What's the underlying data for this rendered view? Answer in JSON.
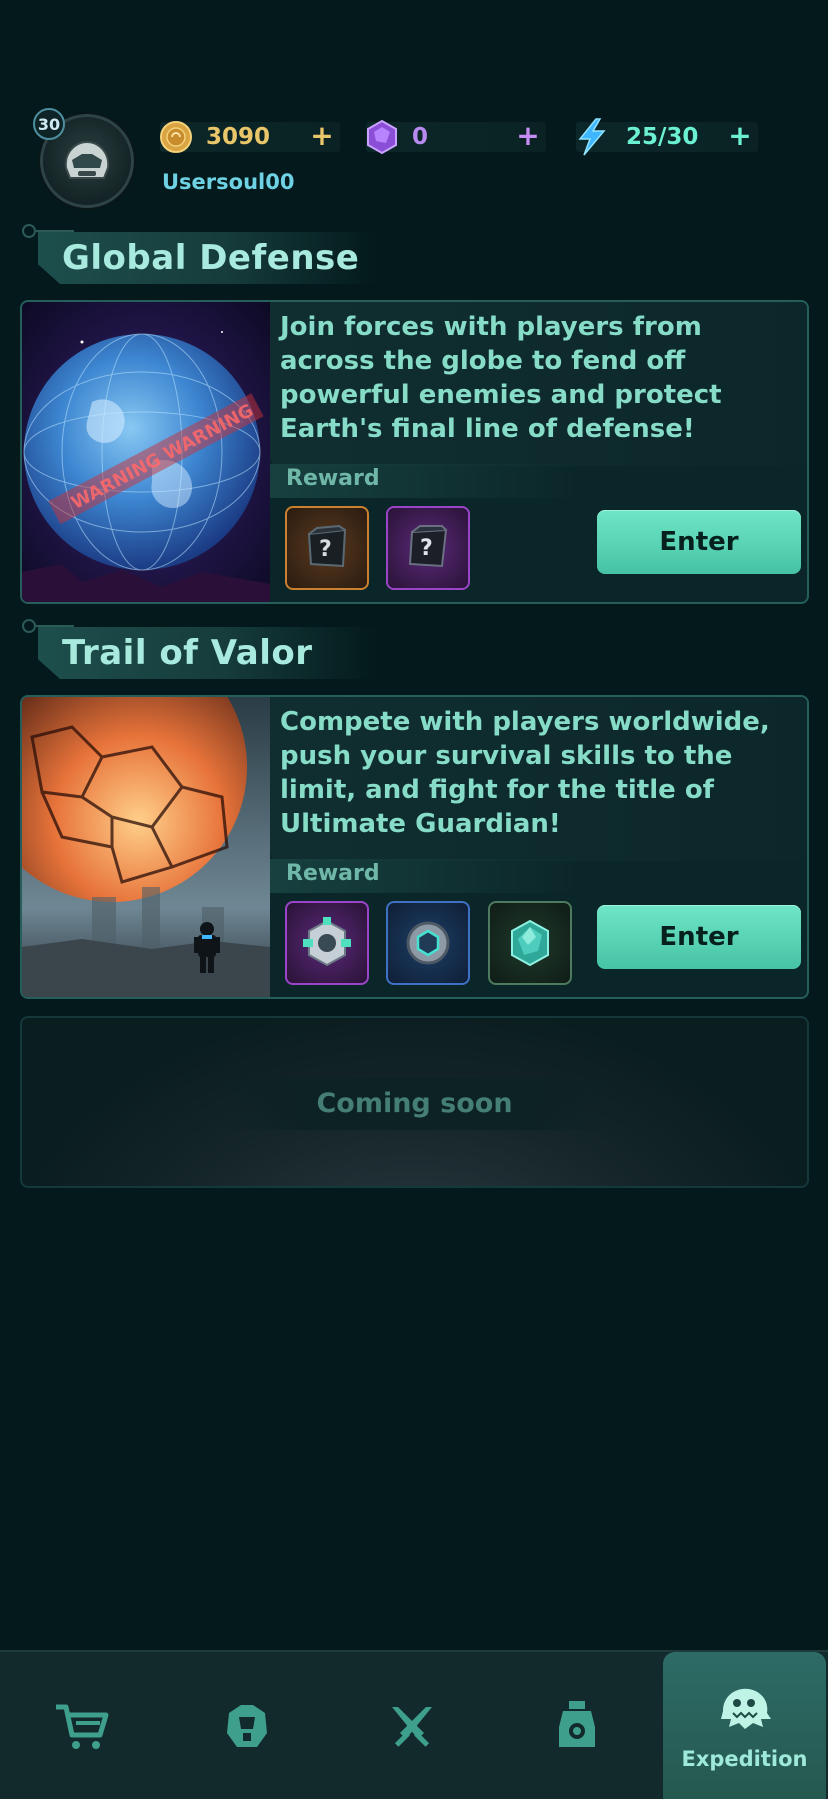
{
  "player": {
    "level": "30",
    "username": "Usersoul00"
  },
  "resources": {
    "coins": {
      "value": "3090",
      "icon": "coin-icon",
      "add_label": "+"
    },
    "gems": {
      "value": "0",
      "icon": "gem-icon",
      "add_label": "+"
    },
    "energy": {
      "value": "25/30",
      "icon": "lightning-icon",
      "add_label": "+"
    }
  },
  "events": [
    {
      "title": "Global Defense",
      "description": "Join forces with players from across the globe to fend off powerful enemies and protect Earth's final line of defense!",
      "reward_label": "Reward",
      "rewards": [
        {
          "icon": "mystery-chest-orange-icon",
          "rarity": "orange"
        },
        {
          "icon": "mystery-chest-purple-icon",
          "rarity": "purple"
        }
      ],
      "enter_label": "Enter",
      "art": "warning-globe",
      "art_text": "WARNING WARNING"
    },
    {
      "title": "Trail of Valor",
      "description": "Compete with players worldwide, push your survival skills to the limit, and fight for the title of Ultimate Guardian!",
      "reward_label": "Reward",
      "rewards": [
        {
          "icon": "gear-core-purple-icon",
          "rarity": "purple"
        },
        {
          "icon": "armor-core-blue-icon",
          "rarity": "blue"
        },
        {
          "icon": "crystal-green-icon",
          "rarity": "green"
        }
      ],
      "enter_label": "Enter",
      "art": "molten-planet-astronaut"
    }
  ],
  "coming_soon": {
    "label": "Coming soon"
  },
  "bottom_nav": {
    "items": [
      {
        "icon": "shop-cart-icon",
        "label": ""
      },
      {
        "icon": "armor-icon",
        "label": ""
      },
      {
        "icon": "crossed-swords-icon",
        "label": ""
      },
      {
        "icon": "robot-icon",
        "label": ""
      },
      {
        "icon": "monster-icon",
        "label": "Expedition",
        "active": true
      }
    ]
  },
  "colors": {
    "background": "#03191b",
    "accent": "#5fd9ba",
    "coin": "#e9c66a",
    "gem": "#b78af0",
    "energy": "#6cf0d2"
  }
}
